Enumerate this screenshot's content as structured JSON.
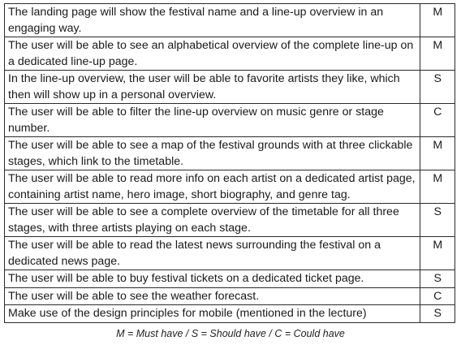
{
  "requirements": [
    {
      "text": "The landing page will show the festival name and a line-up overview in an engaging way.",
      "priority": "M"
    },
    {
      "text": "The user will be able to see an alphabetical overview of the complete line-up on a dedicated line-up page.",
      "priority": "M"
    },
    {
      "text": "In the line-up overview, the user will be able to favorite artists they like, which then will show up in a personal overview.",
      "priority": "S"
    },
    {
      "text": "The user will be able to filter the line-up overview on music genre or stage number.",
      "priority": "C"
    },
    {
      "text": "The user will be able to see a map of the festival grounds with at three clickable stages, which link to the timetable.",
      "priority": "M"
    },
    {
      "text": "The user will be able to read more info on each artist on a dedicated artist page, containing artist name, hero image, short biography, and genre tag.",
      "priority": "M"
    },
    {
      "text": "The user will be able to see a complete overview of the timetable for all three stages, with three artists playing on each stage.",
      "priority": "S"
    },
    {
      "text": "The user will be able to read the latest news surrounding the festival on a dedicated news page.",
      "priority": "M"
    },
    {
      "text": "The user will be able to buy festival tickets on a dedicated ticket page.",
      "priority": "S"
    },
    {
      "text": "The user will be able to see the weather forecast.",
      "priority": "C"
    },
    {
      "text": "Make use of the design principles for mobile (mentioned in the lecture)",
      "priority": "S"
    }
  ],
  "legend": "M = Must have / S = Should have / C = Could have"
}
